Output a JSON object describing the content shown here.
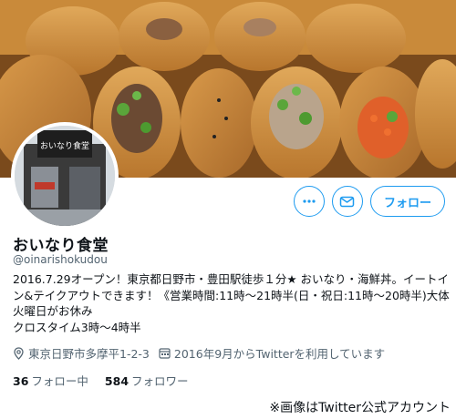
{
  "profile": {
    "name": "おいなり食堂",
    "handle": "@oinarishokudou",
    "bio_lines": [
      "2016.7.29オープン！東京都日野市・豊田駅徒歩１分★ おいなり・海鮮丼。イートイ",
      "ン&テイクアウトできます！《営業時間:11時～21時半(日・祝日:11時～20時半)大体",
      "火曜日がお休み",
      "クロスタイム3時～4時半"
    ],
    "location": "東京日野市多摩平1-2-3",
    "joined": "2016年9月からTwitterを利用しています",
    "following_count": "36",
    "following_label": "フォロー中",
    "followers_count": "584",
    "followers_label": "フォロワー"
  },
  "actions": {
    "follow_label": "フォロー",
    "more_icon": "more-dots-icon",
    "message_icon": "envelope-icon"
  },
  "avatar": {
    "sign_text": "おいなり食堂"
  },
  "caption": "※画像はTwitter公式アカウント",
  "colors": {
    "accent": "#1d9bf0",
    "secondary_text": "#536471",
    "primary_text": "#0f1419"
  }
}
